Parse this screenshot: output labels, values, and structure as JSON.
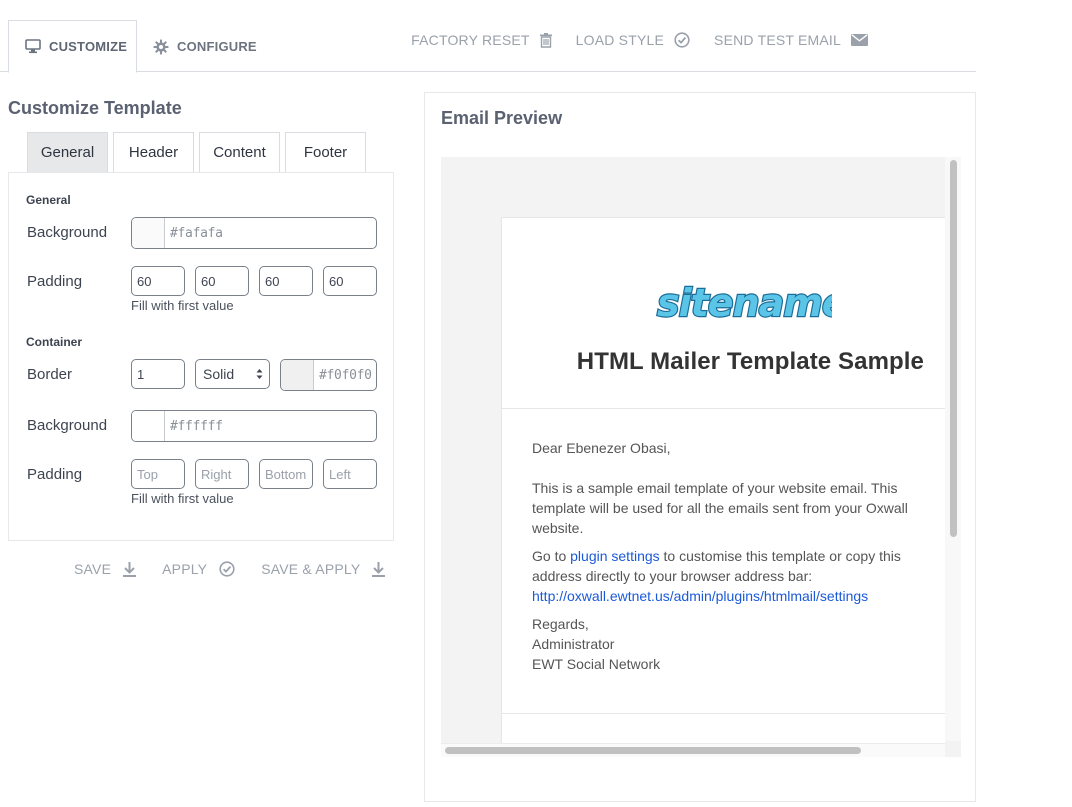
{
  "tabs": {
    "customize": "CUSTOMIZE",
    "configure": "CONFIGURE"
  },
  "toolbar": {
    "factory_reset": "FACTORY RESET",
    "load_style": "LOAD STYLE",
    "send_test_email": "SEND TEST EMAIL"
  },
  "customize": {
    "title": "Customize Template",
    "sub_tabs": [
      "General",
      "Header",
      "Content",
      "Footer"
    ],
    "active_sub_tab": "General",
    "general": {
      "group_label": "General",
      "background_label": "Background",
      "background_value": "#fafafa",
      "background_swatch": "#fafafa",
      "padding_label": "Padding",
      "padding_values": [
        "60",
        "60",
        "60",
        "60"
      ],
      "padding_hint": "Fill with first value"
    },
    "container": {
      "group_label": "Container",
      "border_label": "Border",
      "border_width": "1",
      "border_style": "Solid",
      "border_color": "#f0f0f0",
      "border_swatch": "#f0f0f0",
      "background_label": "Background",
      "background_value": "#ffffff",
      "background_swatch": "#ffffff",
      "padding_label": "Padding",
      "padding_placeholders": [
        "Top",
        "Right",
        "Bottom",
        "Left"
      ],
      "padding_hint": "Fill with first value"
    },
    "actions": {
      "save": "SAVE",
      "apply": "APPLY",
      "save_apply": "SAVE & APPLY"
    }
  },
  "preview": {
    "title": "Email Preview",
    "logo_text": "sitename",
    "email_heading": "HTML Mailer Template Sample",
    "greeting": "Dear Ebenezer Obasi,",
    "para1": "This is a sample email template of your website email. This template will be used for all the emails sent from your Oxwall website.",
    "para2_prefix": "Go to ",
    "para2_link": "plugin settings",
    "para2_suffix": " to customise this template or copy this address directly to your browser address bar:",
    "settings_url": "http://oxwall.ewtnet.us/admin/plugins/htmlmail/settings",
    "regards": "Regards,",
    "signature_name": "Administrator",
    "signature_org": "EWT Social Network"
  },
  "colors": {
    "accent_link": "#1a5ad8",
    "logo_fill": "#5bc5e8",
    "logo_stroke": "#1b6d99"
  }
}
